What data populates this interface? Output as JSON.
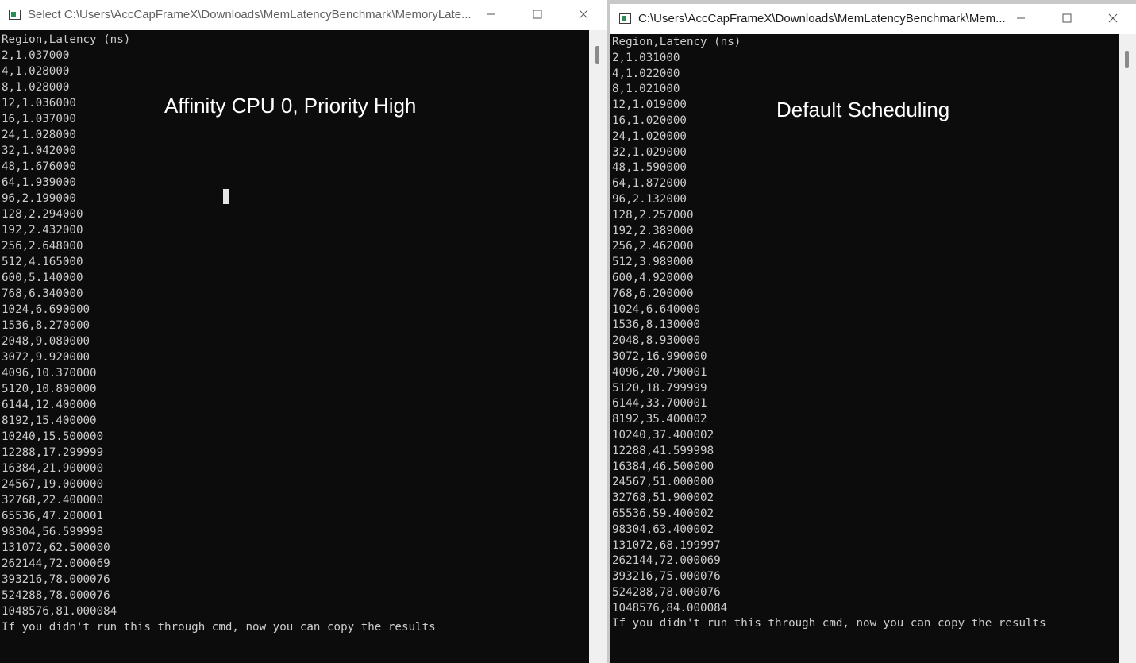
{
  "left_window": {
    "title": "Select C:\\Users\\AccCapFrameX\\Downloads\\MemLatencyBenchmark\\MemoryLate...",
    "overlay_label": "Affinity CPU 0, Priority High",
    "lines": [
      "Region,Latency (ns)",
      "2,1.037000",
      "4,1.028000",
      "8,1.028000",
      "12,1.036000",
      "16,1.037000",
      "24,1.028000",
      "32,1.042000",
      "48,1.676000",
      "64,1.939000",
      "96,2.199000",
      "128,2.294000",
      "192,2.432000",
      "256,2.648000",
      "512,4.165000",
      "600,5.140000",
      "768,6.340000",
      "1024,6.690000",
      "1536,8.270000",
      "2048,9.080000",
      "3072,9.920000",
      "4096,10.370000",
      "5120,10.800000",
      "6144,12.400000",
      "8192,15.400000",
      "10240,15.500000",
      "12288,17.299999",
      "16384,21.900000",
      "24567,19.000000",
      "32768,22.400000",
      "65536,47.200001",
      "98304,56.599998",
      "131072,62.500000",
      "262144,72.000069",
      "393216,78.000076",
      "524288,78.000076",
      "1048576,81.000084",
      "If you didn't run this through cmd, now you can copy the results"
    ]
  },
  "right_window": {
    "title": "C:\\Users\\AccCapFrameX\\Downloads\\MemLatencyBenchmark\\Mem...",
    "overlay_label": "Default Scheduling",
    "lines": [
      "Region,Latency (ns)",
      "2,1.031000",
      "4,1.022000",
      "8,1.021000",
      "12,1.019000",
      "16,1.020000",
      "24,1.020000",
      "32,1.029000",
      "48,1.590000",
      "64,1.872000",
      "96,2.132000",
      "128,2.257000",
      "192,2.389000",
      "256,2.462000",
      "512,3.989000",
      "600,4.920000",
      "768,6.200000",
      "1024,6.640000",
      "1536,8.130000",
      "2048,8.930000",
      "3072,16.990000",
      "4096,20.790001",
      "5120,18.799999",
      "6144,33.700001",
      "8192,35.400002",
      "10240,37.400002",
      "12288,41.599998",
      "16384,46.500000",
      "24567,51.000000",
      "32768,51.900002",
      "65536,59.400002",
      "98304,63.400002",
      "131072,68.199997",
      "262144,72.000069",
      "393216,75.000076",
      "524288,78.000076",
      "1048576,84.000084",
      "If you didn't run this through cmd, now you can copy the results"
    ]
  },
  "colors": {
    "console_bg": "#0c0c0c",
    "console_text": "#cccccc",
    "titlebar_bg": "#ffffff",
    "overlay_text": "#ffffff"
  }
}
